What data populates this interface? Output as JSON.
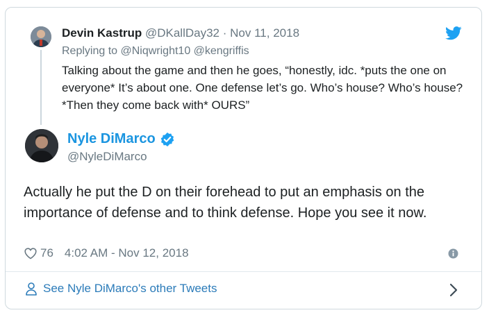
{
  "reply": {
    "author_name": "Devin Kastrup",
    "author_handle": "@DKallDay32",
    "separator": "·",
    "date": "Nov 11, 2018",
    "replying_to": "Replying to @Niqwright10 @kengriffis",
    "text": "Talking about the game and then he goes, “honestly, idc. *puts the one on everyone*  It’s about one. One defense let’s go. Who’s house? Who’s house? *Then they come back with* OURS”"
  },
  "tweet": {
    "author_name": "Nyle DiMarco",
    "author_handle": "@NyleDiMarco",
    "verified": true,
    "text": "Actually he put the D on their forehead to put an emphasis on the importance of defense and to think defense.  Hope you see it now.",
    "likes": "76",
    "timestamp": "4:02 AM - Nov 12, 2018"
  },
  "footer": {
    "see_more_label": "See Nyle DiMarco's other Tweets"
  },
  "icons": {
    "brand": "twitter-bird-icon",
    "like": "heart-icon",
    "info": "info-icon",
    "profile": "person-icon",
    "next": "chevron-right-icon",
    "verified": "verified-badge-icon"
  },
  "colors": {
    "brand_blue": "#1da1f2",
    "name_blue": "#1b95e0",
    "link_blue": "#2b7bb9",
    "muted": "#697882",
    "border": "#cfd9de"
  }
}
